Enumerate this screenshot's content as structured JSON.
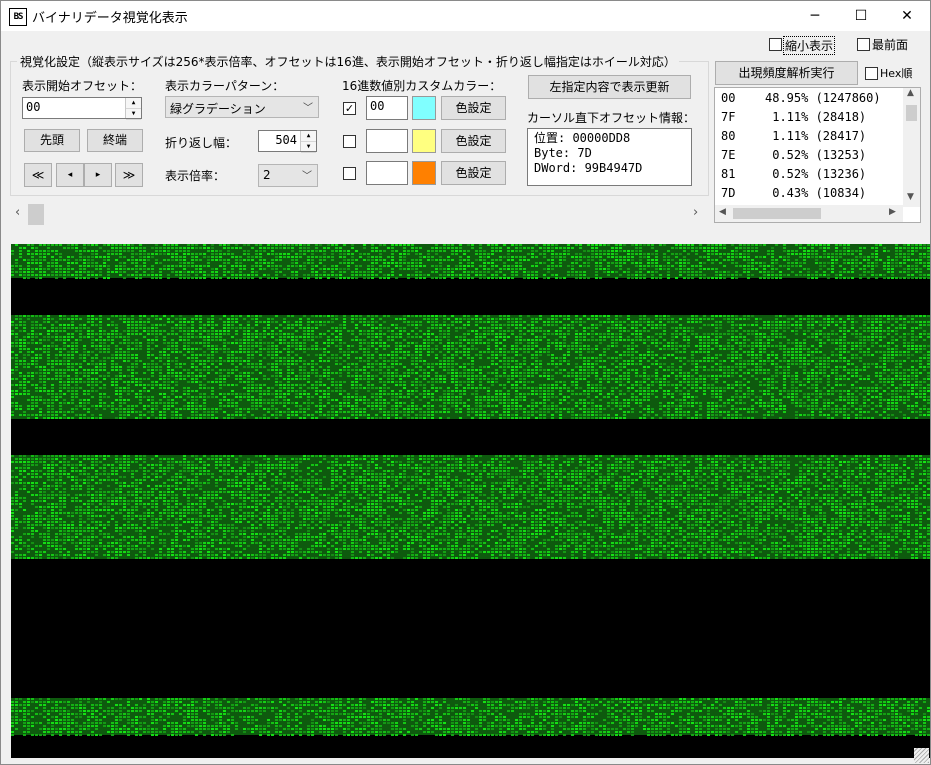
{
  "window": {
    "title": "バイナリデータ視覚化表示",
    "icon_text": "BS",
    "minimize_label": "─",
    "maximize_label": "☐",
    "close_label": "✕"
  },
  "top_options": {
    "shrink_label": "縮小表示",
    "shrink_checked": false,
    "topmost_label": "最前面",
    "topmost_checked": false
  },
  "settings": {
    "group_label": "視覚化設定（縦表示サイズは256*表示倍率、オフセットは16進、表示開始オフセット・折り返し幅指定はホイール対応）",
    "start_offset_label": "表示開始オフセット：",
    "start_offset_value": "00",
    "head_button": "先頭",
    "tail_button": "終端",
    "nav": [
      "≪",
      "◂",
      "▸",
      "≫"
    ],
    "color_pattern_label": "表示カラーパターン：",
    "color_pattern_value": "緑グラデーション",
    "wrap_width_label": "折り返し幅：",
    "wrap_width_value": "504",
    "scale_label": "表示倍率：",
    "scale_value": "2",
    "custom_color_label": "16進数値別カスタムカラー：",
    "custom_colors": [
      {
        "checked": true,
        "value": "00",
        "color": "#80ffff",
        "button": "色設定"
      },
      {
        "checked": false,
        "value": "",
        "color": "#ffff80",
        "button": "色設定"
      },
      {
        "checked": false,
        "value": "",
        "color": "#ff8000",
        "button": "色設定"
      }
    ],
    "refresh_button": "左指定内容で表示更新",
    "cursor_info_label": "カーソル直下オフセット情報：",
    "cursor_info": {
      "position": "位置:  00000DD8",
      "byte": "Byte:  7D",
      "dword": "DWord: 99B4947D"
    },
    "scroll_left": "‹",
    "scroll_right": "›"
  },
  "frequency": {
    "button": "出現頻度解析実行",
    "hex_order_label": "Hex順",
    "hex_order_checked": false,
    "rows": [
      {
        "hex": "00",
        "stat": "48.95% (1247860)"
      },
      {
        "hex": "7F",
        "stat": " 1.11% (28418)"
      },
      {
        "hex": "80",
        "stat": " 1.11% (28417)"
      },
      {
        "hex": "7E",
        "stat": " 0.52% (13253)"
      },
      {
        "hex": "81",
        "stat": " 0.52% (13236)"
      },
      {
        "hex": "7D",
        "stat": " 0.43% (10834)"
      }
    ]
  },
  "visualization": {
    "band_color": "#22b422",
    "background": "#000000"
  }
}
